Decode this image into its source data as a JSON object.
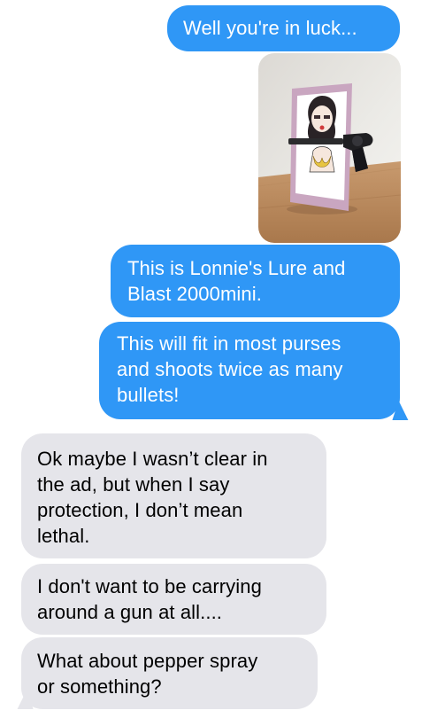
{
  "messages": [
    {
      "id": "m1",
      "sender": "me",
      "text": "Well you're in luck..."
    },
    {
      "id": "m2",
      "sender": "me",
      "type": "image",
      "image_description": "photo"
    },
    {
      "id": "m3",
      "sender": "me",
      "lines": [
        "This is Lonnie's Lure and",
        "Blast 2000mini."
      ]
    },
    {
      "id": "m4",
      "sender": "me",
      "lines": [
        "This will fit in most purses",
        "and shoots twice as many",
        "bullets!"
      ]
    },
    {
      "id": "m5",
      "sender": "them",
      "lines": [
        "Ok maybe I wasn’t clear in",
        "the ad, but when I say",
        "protection, I don’t mean",
        "lethal."
      ]
    },
    {
      "id": "m6",
      "sender": "them",
      "lines": [
        "I don't want to be carrying",
        "around a gun at all...."
      ]
    },
    {
      "id": "m7",
      "sender": "them",
      "lines": [
        "What about pepper spray",
        "or something?"
      ]
    }
  ],
  "colors": {
    "sent_bubble": "#2f97f6",
    "received_bubble": "#e5e5ea",
    "background": "#ffffff"
  }
}
